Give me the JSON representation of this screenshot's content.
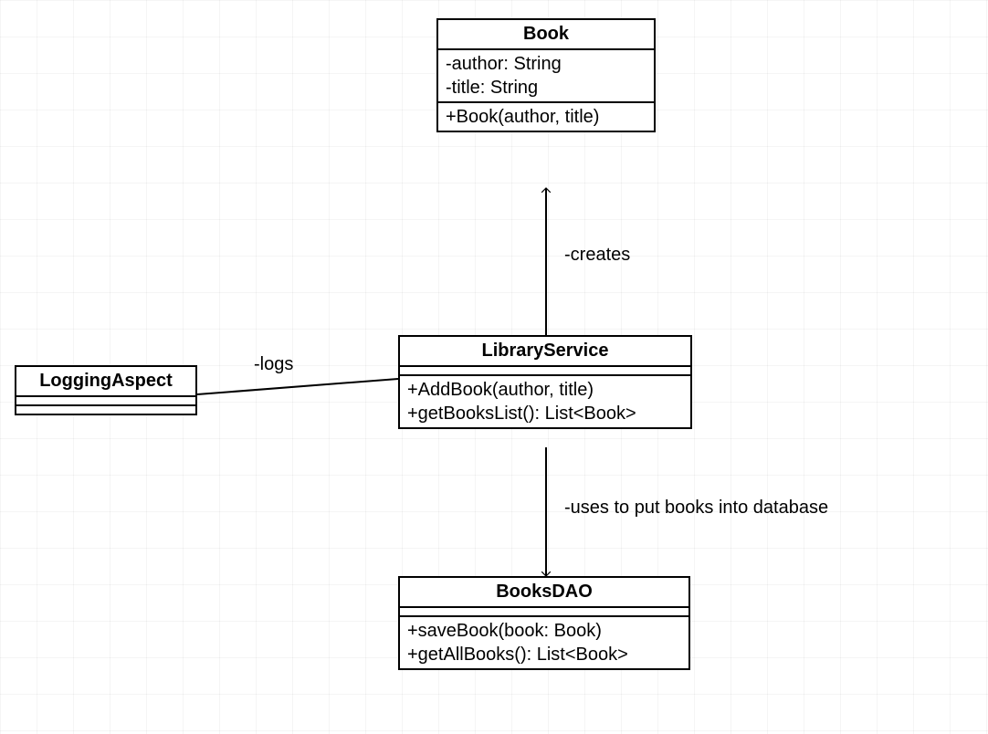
{
  "classes": {
    "book": {
      "name": "Book",
      "attrs_0": "-author: String",
      "attrs_1": "-title: String",
      "ops_0": "+Book(author, title)"
    },
    "libraryService": {
      "name": "LibraryService",
      "ops_0": "+AddBook(author, title)",
      "ops_1": "+getBooksList(): List<Book>"
    },
    "loggingAspect": {
      "name": "LoggingAspect"
    },
    "booksDAO": {
      "name": "BooksDAO",
      "ops_0": "+saveBook(book: Book)",
      "ops_1": "+getAllBooks(): List<Book>"
    }
  },
  "relations": {
    "creates": "-creates",
    "logs": "-logs",
    "uses": "-uses to put books into database"
  }
}
